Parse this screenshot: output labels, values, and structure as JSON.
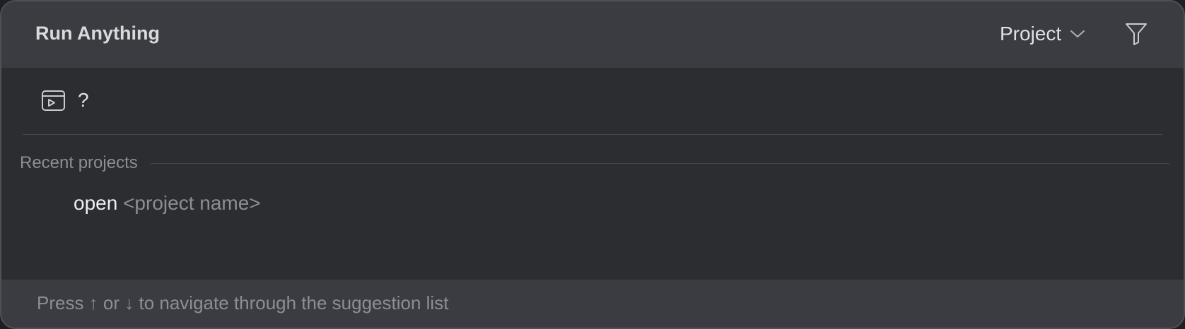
{
  "header": {
    "title": "Run Anything",
    "scope": {
      "selected": "Project",
      "icon": "chevron-down-icon"
    },
    "filter_icon": "filter-icon"
  },
  "search": {
    "icon": "run-anything-icon",
    "value": "?"
  },
  "section": {
    "title": "Recent projects"
  },
  "suggestions": [
    {
      "command": "open",
      "argument": "<project name>"
    }
  ],
  "footer": {
    "hint": "Press ↑ or ↓ to navigate through the suggestion list"
  },
  "colors": {
    "header_bg": "#3b3c41",
    "body_bg": "#2b2d30",
    "text_primary": "#dfe1e5",
    "text_secondary": "#8c8e93"
  }
}
